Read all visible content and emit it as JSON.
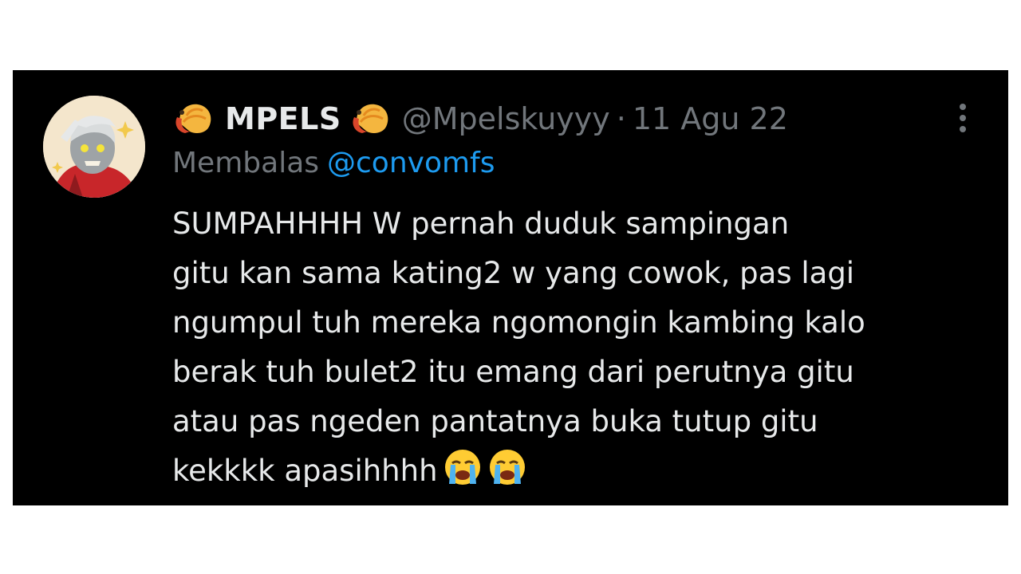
{
  "tweet": {
    "display_name": "MPELS",
    "handle": "@Mpelskuyyy",
    "separator": "·",
    "date": "11 Agu 22",
    "reply_label": "Membalas",
    "reply_target": "@convomfs",
    "text_lines": [
      "SUMPAHHHH W pernah duduk sampingan",
      "gitu kan sama kating2 w yang cowok, pas lagi",
      "ngumpul tuh mereka ngomongin kambing kalo",
      "berak tuh bulet2 itu emang dari perutnya gitu",
      "atau pas ngeden pantatnya buka tutup gitu",
      "kekkkk apasihhhh"
    ],
    "name_emoji": "shrimp-emoji",
    "trailing_emoji": [
      "loudly-crying-face-emoji",
      "loudly-crying-face-emoji"
    ]
  },
  "colors": {
    "background": "#000000",
    "primary_text": "#e7e9ea",
    "secondary_text": "#71767b",
    "link": "#1d9bf0"
  }
}
